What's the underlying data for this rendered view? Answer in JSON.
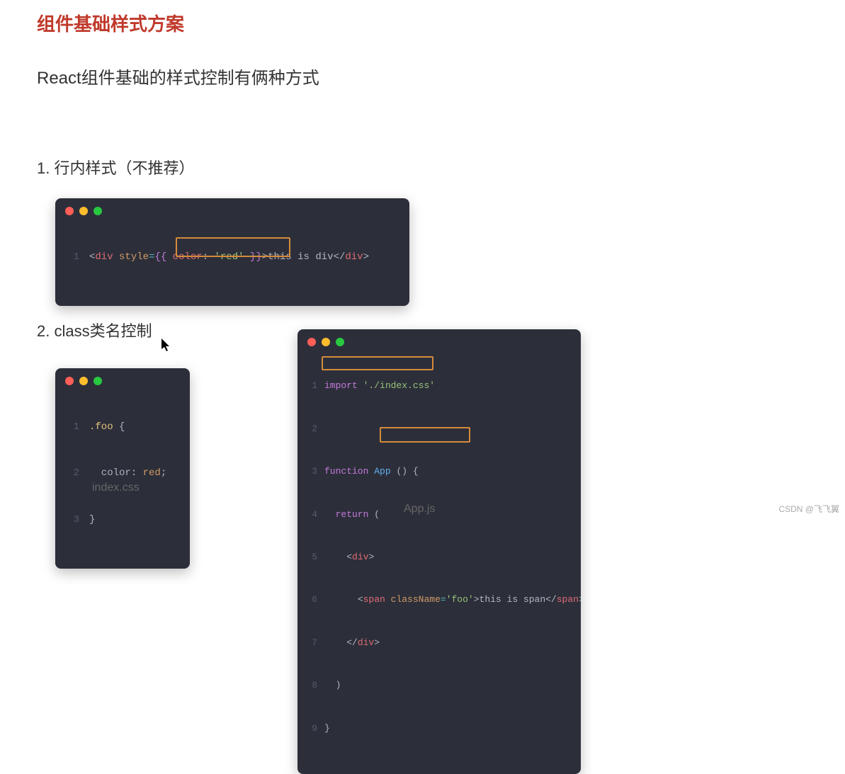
{
  "title": "组件基础样式方案",
  "intro": "React组件基础的样式控制有俩种方式",
  "section1": "1. 行内样式（不推荐）",
  "section2": "2. class类名控制",
  "code1": {
    "line1": {
      "num": "1",
      "open_lt": "<",
      "tag_open": "div",
      "space1": " ",
      "attr": "style",
      "eq": "=",
      "brace_open": "{{ ",
      "prop": "color",
      "colon": ":",
      "space2": " ",
      "val": "'red'",
      "brace_close": " }}",
      "gt": ">",
      "text": "this is div",
      "close_lt": "</",
      "tag_close": "div",
      "close_gt": ">"
    }
  },
  "code2": {
    "caption": "index.css",
    "lines": {
      "n1": "1",
      "n2": "2",
      "n3": "3",
      "l1_sel": ".foo",
      "l1_brace": " {",
      "l2_prop": "  color",
      "l2_colon": ": ",
      "l2_val": "red",
      "l2_semi": ";",
      "l3_brace": "}"
    }
  },
  "code3": {
    "caption": "App.js",
    "lines": {
      "n1": "1",
      "n2": "2",
      "n3": "3",
      "n4": "4",
      "n5": "5",
      "n6": "6",
      "n7": "7",
      "n8": "8",
      "n9": "9",
      "l1_import": "import",
      "l1_sp": " ",
      "l1_str": "'./index.css'",
      "l3_fn": "function",
      "l3_sp1": " ",
      "l3_name": "App",
      "l3_sp2": " ",
      "l3_paren": "()",
      "l3_sp3": " ",
      "l3_brace": "{",
      "l4_ret": "  return",
      "l4_sp": " ",
      "l4_paren": "(",
      "l5_ind": "    ",
      "l5_lt": "<",
      "l5_tag": "div",
      "l5_gt": ">",
      "l6_ind": "      ",
      "l6_lt": "<",
      "l6_tag": "span",
      "l6_sp": " ",
      "l6_attr": "className",
      "l6_eq": "=",
      "l6_val": "'foo'",
      "l6_gt": ">",
      "l6_txt": "this is span",
      "l6_clt": "</",
      "l6_ctag": "span",
      "l6_cgt": ">",
      "l7_ind": "    ",
      "l7_clt": "</",
      "l7_tag": "div",
      "l7_gt": ">",
      "l8_ind": "  ",
      "l8_paren": ")",
      "l9_brace": "}"
    }
  },
  "watermark": "CSDN @飞飞翼"
}
